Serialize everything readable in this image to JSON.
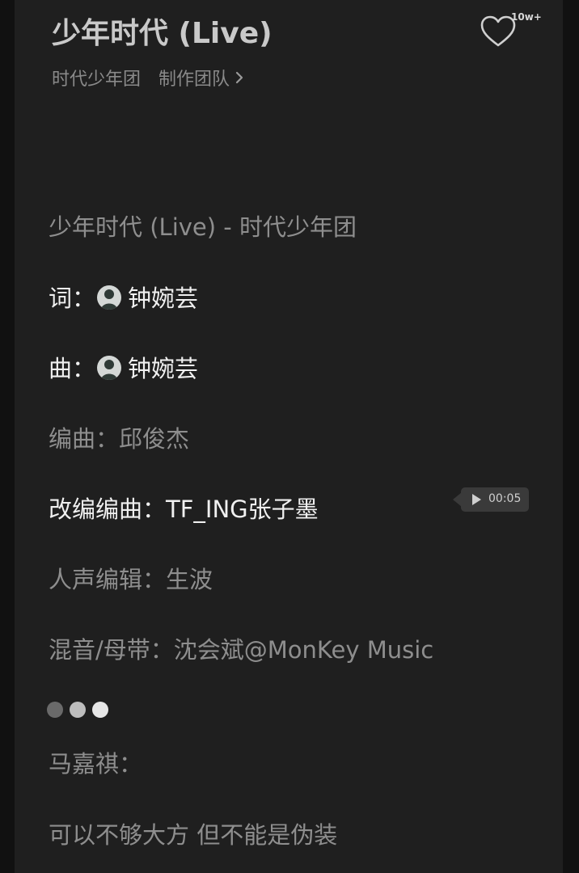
{
  "header": {
    "title": "少年时代 (Live)",
    "artist": "时代少年团",
    "team_link": "制作团队",
    "like_count": "10w+"
  },
  "credits": {
    "song_line": "少年时代 (Live) - 时代少年团",
    "lyrics_label": "词：",
    "lyrics_name": "钟婉芸",
    "music_label": "曲：",
    "music_name": "钟婉芸",
    "arrange_line": "编曲：邱俊杰",
    "rearrange_line": "改编编曲：TF_ING张子墨",
    "vocal_edit_line": "人声编辑：生波",
    "mix_line": "混音/母带：沈会斌@MonKey Music"
  },
  "audio_chip": {
    "duration": "00:05"
  },
  "lyrics": {
    "singer": "马嘉祺：",
    "line1": "可以不够大方 但不能是伪装"
  },
  "colors": {
    "background": "#1f1f1f",
    "text_dim": "#8e8e8e",
    "text_bright": "#f0f0f0",
    "chip": "#3a3a3a"
  },
  "icons": {
    "like": "heart-outline-icon",
    "chevron": "chevron-right-icon",
    "play": "play-icon",
    "dots": "three-dots-indicator"
  }
}
